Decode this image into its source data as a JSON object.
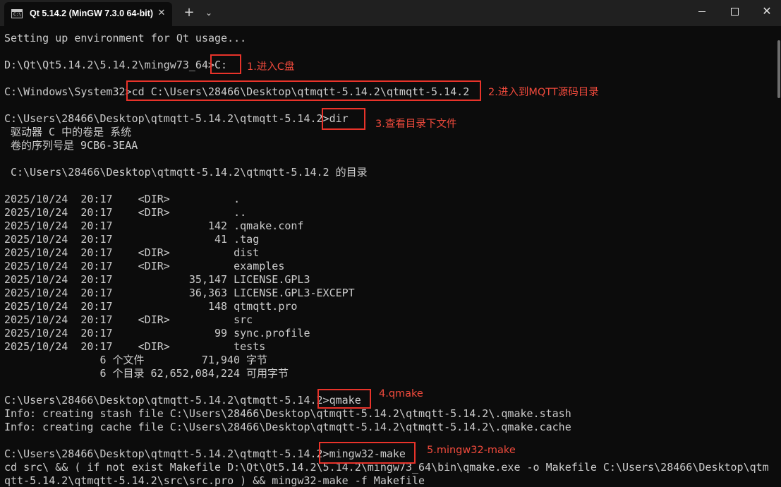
{
  "window": {
    "tab_title": "Qt 5.14.2 (MinGW 7.3.0 64-bit)",
    "tab_icon_text": "C:\\",
    "close_tab": "✕",
    "new_tab": "+",
    "dropdown": "⌄",
    "close_window": "✕"
  },
  "terminal": {
    "lines": [
      "Setting up environment for Qt usage...",
      "",
      "D:\\Qt\\Qt5.14.2\\5.14.2\\mingw73_64>C:",
      "",
      "C:\\Windows\\System32>cd C:\\Users\\28466\\Desktop\\qtmqtt-5.14.2\\qtmqtt-5.14.2",
      "",
      "C:\\Users\\28466\\Desktop\\qtmqtt-5.14.2\\qtmqtt-5.14.2>dir",
      " 驱动器 C 中的卷是 系统",
      " 卷的序列号是 9CB6-3EAA",
      "",
      " C:\\Users\\28466\\Desktop\\qtmqtt-5.14.2\\qtmqtt-5.14.2 的目录",
      "",
      "2025/10/24  20:17    <DIR>          .",
      "2025/10/24  20:17    <DIR>          ..",
      "2025/10/24  20:17               142 .qmake.conf",
      "2025/10/24  20:17                41 .tag",
      "2025/10/24  20:17    <DIR>          dist",
      "2025/10/24  20:17    <DIR>          examples",
      "2025/10/24  20:17            35,147 LICENSE.GPL3",
      "2025/10/24  20:17            36,363 LICENSE.GPL3-EXCEPT",
      "2025/10/24  20:17               148 qtmqtt.pro",
      "2025/10/24  20:17    <DIR>          src",
      "2025/10/24  20:17                99 sync.profile",
      "2025/10/24  20:17    <DIR>          tests",
      "               6 个文件         71,940 字节",
      "               6 个目录 62,652,084,224 可用字节",
      "",
      "C:\\Users\\28466\\Desktop\\qtmqtt-5.14.2\\qtmqtt-5.14.2>qmake",
      "Info: creating stash file C:\\Users\\28466\\Desktop\\qtmqtt-5.14.2\\qtmqtt-5.14.2\\.qmake.stash",
      "Info: creating cache file C:\\Users\\28466\\Desktop\\qtmqtt-5.14.2\\qtmqtt-5.14.2\\.qmake.cache",
      "",
      "C:\\Users\\28466\\Desktop\\qtmqtt-5.14.2\\qtmqtt-5.14.2>mingw32-make",
      "cd src\\ && ( if not exist Makefile D:\\Qt\\Qt5.14.2\\5.14.2\\mingw73_64\\bin\\qmake.exe -o Makefile C:\\Users\\28466\\Desktop\\qtm",
      "qtt-5.14.2\\qtmqtt-5.14.2\\src\\src.pro ) && mingw32-make -f Makefile"
    ]
  },
  "annotations": {
    "step1": "1.进入C盘",
    "step2": "2.进入到MQTT源码目录",
    "step3": "3.查看目录下文件",
    "step4": "4.qmake",
    "step5": "5.mingw32-make"
  },
  "colors": {
    "background": "#0c0c0c",
    "titlebar": "#202020",
    "text": "#cccccc",
    "annotation": "#e8332a"
  }
}
